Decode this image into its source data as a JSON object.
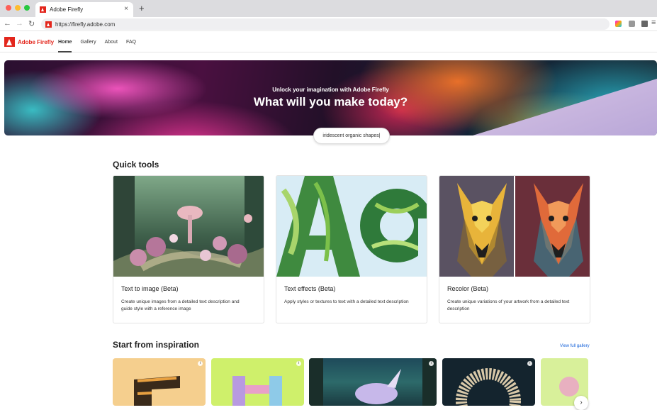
{
  "browser": {
    "tab_title": "Adobe Firefly",
    "close_glyph": "×",
    "newtab_glyph": "+",
    "url": "https://firefly.adobe.com",
    "back_glyph": "←",
    "forward_glyph": "→",
    "reload_glyph": "↻",
    "menu_glyph": "≡"
  },
  "site": {
    "brand": "Adobe Firefly",
    "nav": [
      {
        "label": "Home",
        "active": true
      },
      {
        "label": "Gallery"
      },
      {
        "label": "About"
      },
      {
        "label": "FAQ"
      }
    ]
  },
  "hero": {
    "subtitle": "Unlock your imagination with Adobe Firefly",
    "title": "What will you make today?",
    "prompt_value": "iridescent organic shapes|"
  },
  "quick_tools": {
    "heading": "Quick tools",
    "cards": [
      {
        "title": "Text to image (Beta)",
        "description": "Create unique images from a detailed text description and guide style with a reference image"
      },
      {
        "title": "Text effects (Beta)",
        "description": "Apply styles or textures to text with a detailed text description"
      },
      {
        "title": "Recolor (Beta)",
        "description": "Create unique variations of your artwork from a detailed text description"
      }
    ]
  },
  "inspiration": {
    "heading": "Start from inspiration",
    "view_all": "View full gallery",
    "info_glyph": "i",
    "next_glyph": "›"
  },
  "colors": {
    "brand": "#e3261c",
    "link": "#1461d9"
  }
}
